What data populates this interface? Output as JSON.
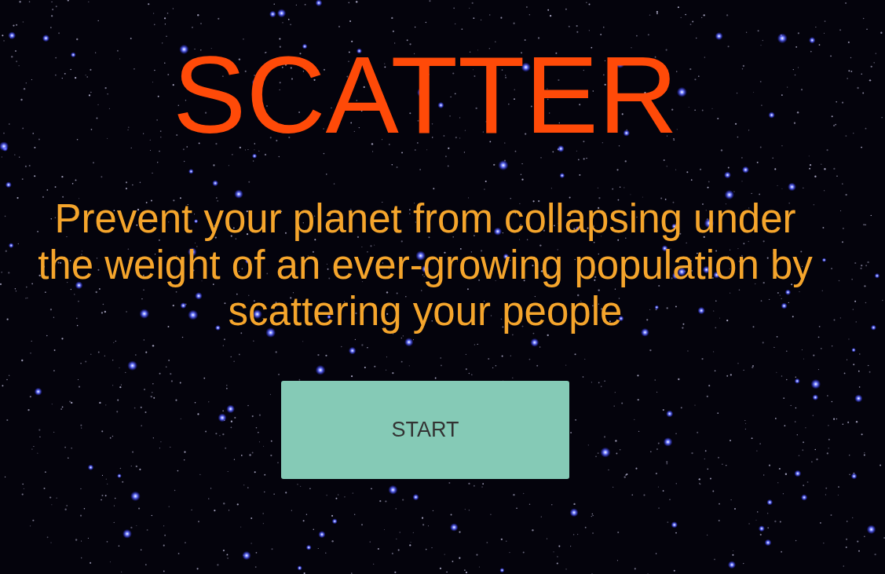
{
  "title": "SCATTER",
  "tagline": "Prevent your planet from collapsing under the weight of an ever-growing population by scattering your people",
  "start_button": {
    "label": "START"
  }
}
